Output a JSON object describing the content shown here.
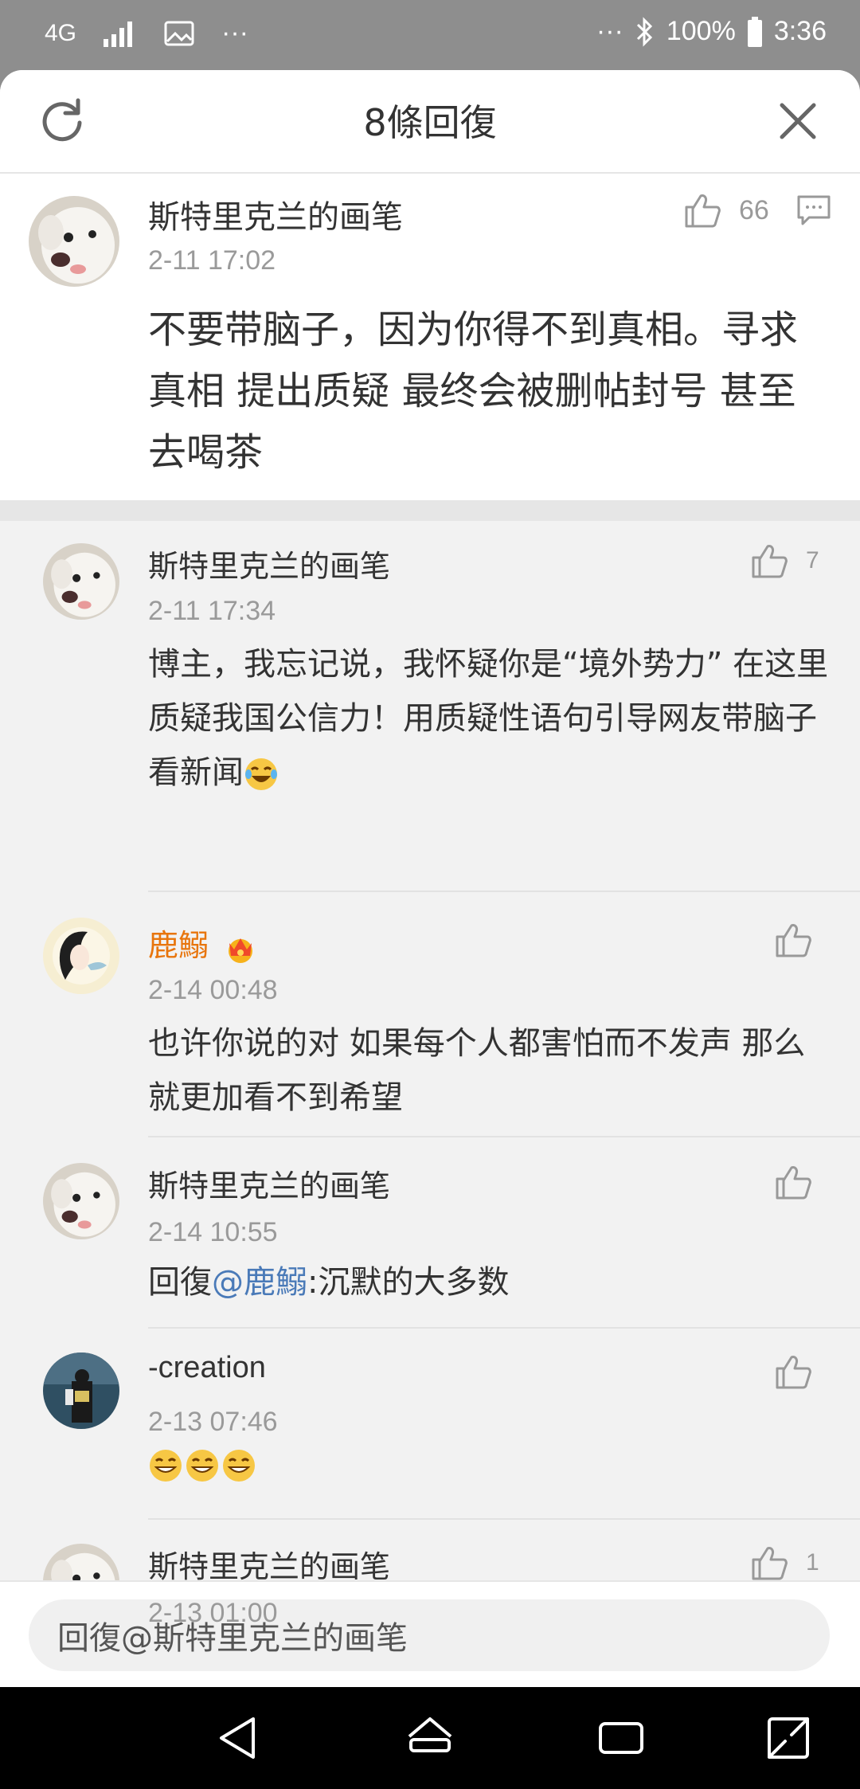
{
  "status_bar": {
    "network": "4G",
    "more": "···",
    "battery": "100%",
    "time": "3:36"
  },
  "header": {
    "title": "8條回復",
    "refresh_icon": "refresh-icon",
    "close_icon": "close-icon"
  },
  "main_comment": {
    "username": "斯特里克兰的画笔",
    "time": "2-11 17:02",
    "likes": "66",
    "content": "不要带脑子，因为你得不到真相。寻求真相 提出质疑 最终会被删帖封号 甚至去喝茶"
  },
  "replies": [
    {
      "username": "斯特里克兰的画笔",
      "time": "2-11 17:34",
      "likes": "7",
      "content": "博主，我忘记说，我怀疑你是“境外势力” 在这里质疑我国公信力！用质疑性语句引导网友带脑子看新闻"
    },
    {
      "username": "鹿鰯",
      "time": "2-14 00:48",
      "likes": "",
      "content": "也许你说的对 如果每个人都害怕而不发声 那么就更加看不到希望"
    },
    {
      "username": "斯特里克兰的画笔",
      "time": "2-14 10:55",
      "likes": "",
      "content_prefix": "回復",
      "mention": "@鹿鰯",
      "content_suffix": ":沉默的大多数"
    },
    {
      "username": "-creation",
      "time": "2-13 07:46",
      "likes": "",
      "content": ""
    },
    {
      "username": "斯特里克兰的画笔",
      "time": "2-13 01:00",
      "likes": "1",
      "content": ""
    }
  ],
  "reply_input": {
    "placeholder": "回復@斯特里克兰的画笔"
  },
  "colors": {
    "accent_mention": "#4a7ab8",
    "vip_name": "#e8750c"
  }
}
